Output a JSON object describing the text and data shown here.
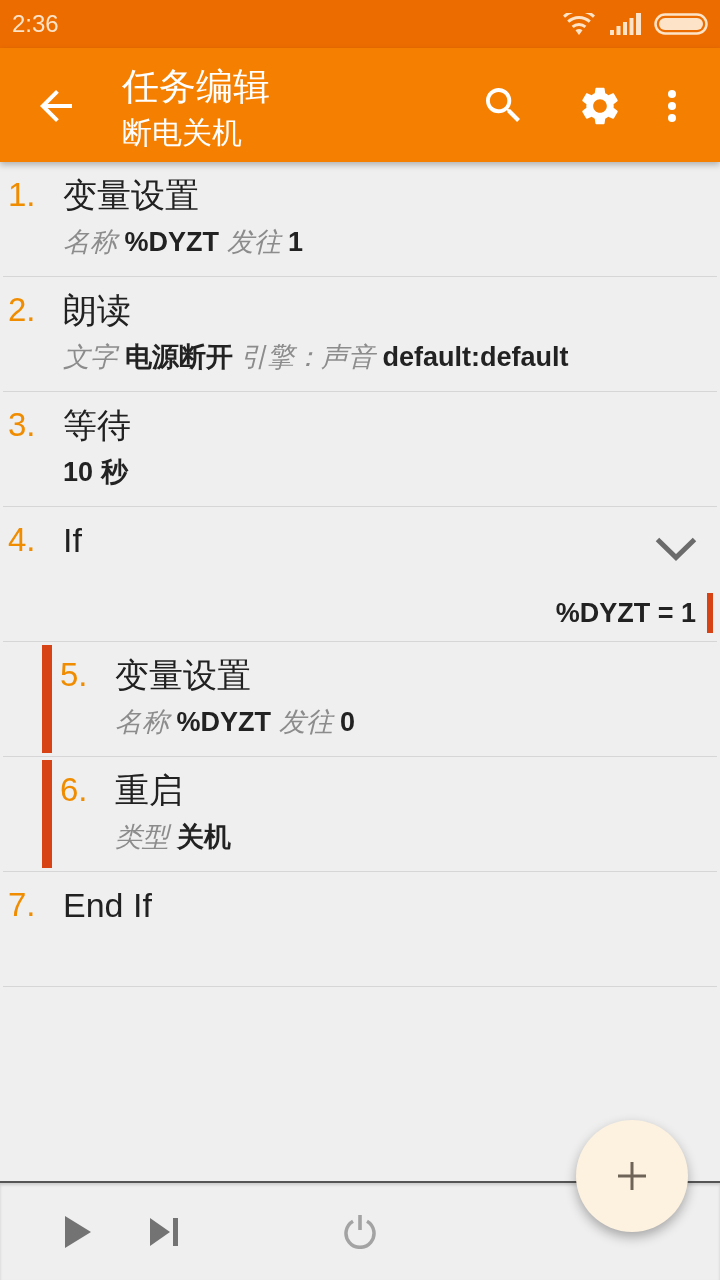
{
  "status_bar": {
    "time": "2:36"
  },
  "app_bar": {
    "title": "任务编辑",
    "subtitle": "断电关机"
  },
  "actions": [
    {
      "number": "1.",
      "name": "变量设置",
      "details": [
        {
          "kind": "label",
          "text": "名称"
        },
        {
          "kind": "value",
          "text": "%DYZT"
        },
        {
          "kind": "label",
          "text": "发往"
        },
        {
          "kind": "value",
          "text": "1"
        }
      ]
    },
    {
      "number": "2.",
      "name": "朗读",
      "details": [
        {
          "kind": "label",
          "text": "文字"
        },
        {
          "kind": "value",
          "text": "电源断开"
        },
        {
          "kind": "label",
          "text": "引擎：声音"
        },
        {
          "kind": "value",
          "text": "default:default"
        }
      ]
    },
    {
      "number": "3.",
      "name": "等待",
      "details": [
        {
          "kind": "value",
          "text": "10 秒"
        }
      ]
    },
    {
      "number": "4.",
      "name": "If",
      "condition": "%DYZT = 1",
      "children": [
        {
          "number": "5.",
          "name": "变量设置",
          "details": [
            {
              "kind": "label",
              "text": "名称"
            },
            {
              "kind": "value",
              "text": "%DYZT"
            },
            {
              "kind": "label",
              "text": "发往"
            },
            {
              "kind": "value",
              "text": "0"
            }
          ]
        },
        {
          "number": "6.",
          "name": "重启",
          "details": [
            {
              "kind": "label",
              "text": "类型"
            },
            {
              "kind": "value",
              "text": "关机"
            }
          ]
        }
      ]
    },
    {
      "number": "7.",
      "name": "End If"
    }
  ]
}
